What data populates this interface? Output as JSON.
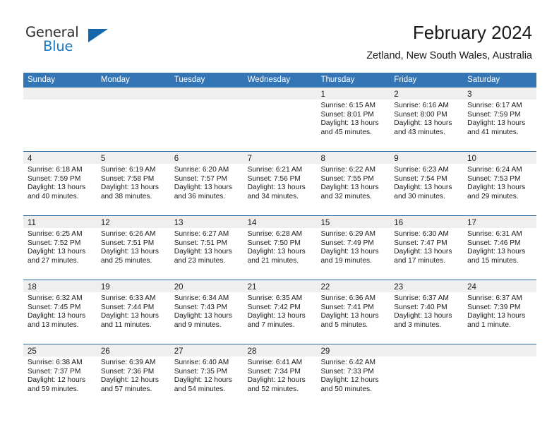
{
  "brand": {
    "name_part1": "General",
    "name_part2": "Blue",
    "accent_color": "#1879c4",
    "triangle_color": "#1466ad",
    "logo_icon": "triangle-flag-icon"
  },
  "header": {
    "month_title": "February 2024",
    "location": "Zetland, New South Wales, Australia"
  },
  "calendar": {
    "header_color": "#3476b5",
    "row_divider_color": "#2e6da4",
    "day_band_color": "#efefef",
    "weekdays": [
      "Sunday",
      "Monday",
      "Tuesday",
      "Wednesday",
      "Thursday",
      "Friday",
      "Saturday"
    ],
    "weeks": [
      [
        {
          "day": "",
          "sunrise": "",
          "sunset": "",
          "daylight_line1": "",
          "daylight_line2": ""
        },
        {
          "day": "",
          "sunrise": "",
          "sunset": "",
          "daylight_line1": "",
          "daylight_line2": ""
        },
        {
          "day": "",
          "sunrise": "",
          "sunset": "",
          "daylight_line1": "",
          "daylight_line2": ""
        },
        {
          "day": "",
          "sunrise": "",
          "sunset": "",
          "daylight_line1": "",
          "daylight_line2": ""
        },
        {
          "day": "1",
          "sunrise": "Sunrise: 6:15 AM",
          "sunset": "Sunset: 8:01 PM",
          "daylight_line1": "Daylight: 13 hours",
          "daylight_line2": "and 45 minutes."
        },
        {
          "day": "2",
          "sunrise": "Sunrise: 6:16 AM",
          "sunset": "Sunset: 8:00 PM",
          "daylight_line1": "Daylight: 13 hours",
          "daylight_line2": "and 43 minutes."
        },
        {
          "day": "3",
          "sunrise": "Sunrise: 6:17 AM",
          "sunset": "Sunset: 7:59 PM",
          "daylight_line1": "Daylight: 13 hours",
          "daylight_line2": "and 41 minutes."
        }
      ],
      [
        {
          "day": "4",
          "sunrise": "Sunrise: 6:18 AM",
          "sunset": "Sunset: 7:59 PM",
          "daylight_line1": "Daylight: 13 hours",
          "daylight_line2": "and 40 minutes."
        },
        {
          "day": "5",
          "sunrise": "Sunrise: 6:19 AM",
          "sunset": "Sunset: 7:58 PM",
          "daylight_line1": "Daylight: 13 hours",
          "daylight_line2": "and 38 minutes."
        },
        {
          "day": "6",
          "sunrise": "Sunrise: 6:20 AM",
          "sunset": "Sunset: 7:57 PM",
          "daylight_line1": "Daylight: 13 hours",
          "daylight_line2": "and 36 minutes."
        },
        {
          "day": "7",
          "sunrise": "Sunrise: 6:21 AM",
          "sunset": "Sunset: 7:56 PM",
          "daylight_line1": "Daylight: 13 hours",
          "daylight_line2": "and 34 minutes."
        },
        {
          "day": "8",
          "sunrise": "Sunrise: 6:22 AM",
          "sunset": "Sunset: 7:55 PM",
          "daylight_line1": "Daylight: 13 hours",
          "daylight_line2": "and 32 minutes."
        },
        {
          "day": "9",
          "sunrise": "Sunrise: 6:23 AM",
          "sunset": "Sunset: 7:54 PM",
          "daylight_line1": "Daylight: 13 hours",
          "daylight_line2": "and 30 minutes."
        },
        {
          "day": "10",
          "sunrise": "Sunrise: 6:24 AM",
          "sunset": "Sunset: 7:53 PM",
          "daylight_line1": "Daylight: 13 hours",
          "daylight_line2": "and 29 minutes."
        }
      ],
      [
        {
          "day": "11",
          "sunrise": "Sunrise: 6:25 AM",
          "sunset": "Sunset: 7:52 PM",
          "daylight_line1": "Daylight: 13 hours",
          "daylight_line2": "and 27 minutes."
        },
        {
          "day": "12",
          "sunrise": "Sunrise: 6:26 AM",
          "sunset": "Sunset: 7:51 PM",
          "daylight_line1": "Daylight: 13 hours",
          "daylight_line2": "and 25 minutes."
        },
        {
          "day": "13",
          "sunrise": "Sunrise: 6:27 AM",
          "sunset": "Sunset: 7:51 PM",
          "daylight_line1": "Daylight: 13 hours",
          "daylight_line2": "and 23 minutes."
        },
        {
          "day": "14",
          "sunrise": "Sunrise: 6:28 AM",
          "sunset": "Sunset: 7:50 PM",
          "daylight_line1": "Daylight: 13 hours",
          "daylight_line2": "and 21 minutes."
        },
        {
          "day": "15",
          "sunrise": "Sunrise: 6:29 AM",
          "sunset": "Sunset: 7:49 PM",
          "daylight_line1": "Daylight: 13 hours",
          "daylight_line2": "and 19 minutes."
        },
        {
          "day": "16",
          "sunrise": "Sunrise: 6:30 AM",
          "sunset": "Sunset: 7:47 PM",
          "daylight_line1": "Daylight: 13 hours",
          "daylight_line2": "and 17 minutes."
        },
        {
          "day": "17",
          "sunrise": "Sunrise: 6:31 AM",
          "sunset": "Sunset: 7:46 PM",
          "daylight_line1": "Daylight: 13 hours",
          "daylight_line2": "and 15 minutes."
        }
      ],
      [
        {
          "day": "18",
          "sunrise": "Sunrise: 6:32 AM",
          "sunset": "Sunset: 7:45 PM",
          "daylight_line1": "Daylight: 13 hours",
          "daylight_line2": "and 13 minutes."
        },
        {
          "day": "19",
          "sunrise": "Sunrise: 6:33 AM",
          "sunset": "Sunset: 7:44 PM",
          "daylight_line1": "Daylight: 13 hours",
          "daylight_line2": "and 11 minutes."
        },
        {
          "day": "20",
          "sunrise": "Sunrise: 6:34 AM",
          "sunset": "Sunset: 7:43 PM",
          "daylight_line1": "Daylight: 13 hours",
          "daylight_line2": "and 9 minutes."
        },
        {
          "day": "21",
          "sunrise": "Sunrise: 6:35 AM",
          "sunset": "Sunset: 7:42 PM",
          "daylight_line1": "Daylight: 13 hours",
          "daylight_line2": "and 7 minutes."
        },
        {
          "day": "22",
          "sunrise": "Sunrise: 6:36 AM",
          "sunset": "Sunset: 7:41 PM",
          "daylight_line1": "Daylight: 13 hours",
          "daylight_line2": "and 5 minutes."
        },
        {
          "day": "23",
          "sunrise": "Sunrise: 6:37 AM",
          "sunset": "Sunset: 7:40 PM",
          "daylight_line1": "Daylight: 13 hours",
          "daylight_line2": "and 3 minutes."
        },
        {
          "day": "24",
          "sunrise": "Sunrise: 6:37 AM",
          "sunset": "Sunset: 7:39 PM",
          "daylight_line1": "Daylight: 13 hours",
          "daylight_line2": "and 1 minute."
        }
      ],
      [
        {
          "day": "25",
          "sunrise": "Sunrise: 6:38 AM",
          "sunset": "Sunset: 7:37 PM",
          "daylight_line1": "Daylight: 12 hours",
          "daylight_line2": "and 59 minutes."
        },
        {
          "day": "26",
          "sunrise": "Sunrise: 6:39 AM",
          "sunset": "Sunset: 7:36 PM",
          "daylight_line1": "Daylight: 12 hours",
          "daylight_line2": "and 57 minutes."
        },
        {
          "day": "27",
          "sunrise": "Sunrise: 6:40 AM",
          "sunset": "Sunset: 7:35 PM",
          "daylight_line1": "Daylight: 12 hours",
          "daylight_line2": "and 54 minutes."
        },
        {
          "day": "28",
          "sunrise": "Sunrise: 6:41 AM",
          "sunset": "Sunset: 7:34 PM",
          "daylight_line1": "Daylight: 12 hours",
          "daylight_line2": "and 52 minutes."
        },
        {
          "day": "29",
          "sunrise": "Sunrise: 6:42 AM",
          "sunset": "Sunset: 7:33 PM",
          "daylight_line1": "Daylight: 12 hours",
          "daylight_line2": "and 50 minutes."
        },
        {
          "day": "",
          "sunrise": "",
          "sunset": "",
          "daylight_line1": "",
          "daylight_line2": ""
        },
        {
          "day": "",
          "sunrise": "",
          "sunset": "",
          "daylight_line1": "",
          "daylight_line2": ""
        }
      ]
    ]
  }
}
